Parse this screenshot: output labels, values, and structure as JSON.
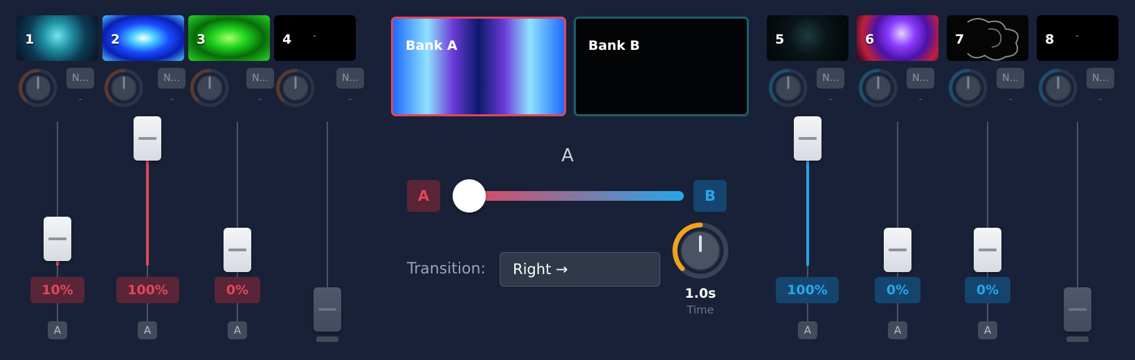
{
  "channels_left": [
    {
      "num": "1",
      "btn": "N...",
      "dash": "-",
      "pct": "10%",
      "assign": "A"
    },
    {
      "num": "2",
      "btn": "N...",
      "dash": "-",
      "pct": "100%",
      "assign": "A"
    },
    {
      "num": "3",
      "btn": "N...",
      "dash": "-",
      "pct": "0%",
      "assign": "A"
    },
    {
      "num": "4",
      "btn": "N...",
      "dash": "-",
      "thumb_dash": "-"
    }
  ],
  "channels_right": [
    {
      "num": "5",
      "btn": "N...",
      "dash": "-",
      "pct": "100%",
      "assign": "A"
    },
    {
      "num": "6",
      "btn": "N...",
      "dash": "-",
      "pct": "0%",
      "assign": "A"
    },
    {
      "num": "7",
      "btn": "N...",
      "dash": "-",
      "pct": "0%",
      "assign": "A"
    },
    {
      "num": "8",
      "btn": "N...",
      "dash": "-",
      "thumb_dash": "-"
    }
  ],
  "channel_levels": [
    0.1,
    1.0,
    0.0,
    0.0,
    1.0,
    0.0,
    0.0,
    0.0
  ],
  "banks": {
    "a_label": "Bank A",
    "b_label": "Bank B"
  },
  "crossfader": {
    "position_label": "A",
    "a_btn": "A",
    "b_btn": "B",
    "position": 0.0
  },
  "transition": {
    "label": "Transition:",
    "value": "Right →",
    "time_value": "1.0s",
    "time_label": "Time"
  },
  "colors": {
    "bank_a": "#e0475e",
    "bank_b": "#27a6ea",
    "time_knob": "#f2a21b"
  }
}
